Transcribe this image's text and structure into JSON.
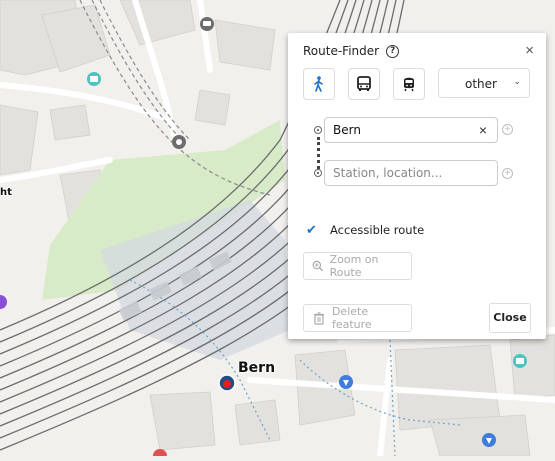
{
  "map": {
    "station_label": "Bern",
    "edge_label": "ht"
  },
  "panel": {
    "title": "Route-Finder",
    "help_icon": "?",
    "close_icon": "×",
    "modes": {
      "walk": "walk-icon",
      "bus": "bus-icon",
      "train": "train-icon"
    },
    "mode_select": {
      "value": "other"
    },
    "origin": {
      "value": "Bern",
      "clear": "×"
    },
    "destination": {
      "value": "",
      "placeholder": "Station, location..."
    },
    "accessible": {
      "checked": true,
      "label": "Accessible route"
    },
    "zoom_button": "Zoom on Route",
    "delete_button": "Delete feature",
    "close_button": "Close"
  },
  "colors": {
    "accent": "#1a73c8",
    "rail": "#555555",
    "park": "#d8ebc8",
    "water_icon": "#4cc5c0",
    "poi": "#3d7de0"
  }
}
